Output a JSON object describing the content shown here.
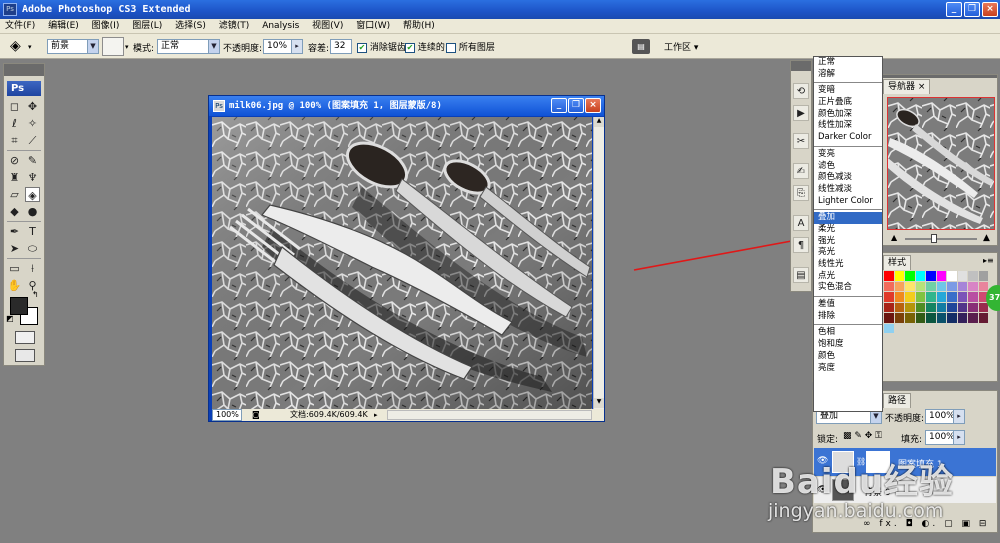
{
  "app": {
    "title": "Adobe Photoshop CS3 Extended",
    "ps_badge": "Ps",
    "window_buttons": {
      "minimize": "_",
      "restore": "❐",
      "close": "×"
    }
  },
  "menubar": [
    "文件(F)",
    "编辑(E)",
    "图像(I)",
    "图层(L)",
    "选择(S)",
    "滤镜(T)",
    "Analysis",
    "视图(V)",
    "窗口(W)",
    "帮助(H)"
  ],
  "options_bar": {
    "fill_source": "前景",
    "mode_label": "模式:",
    "mode_value": "正常",
    "opacity_label": "不透明度:",
    "opacity_value": "10%",
    "tolerance_label": "容差:",
    "tolerance_value": "32",
    "antialias_label": "消除锯齿",
    "contiguous_label": "连续的",
    "all_layers_label": "所有图层",
    "workspace_label": "工作区"
  },
  "toolbox": {
    "logo": "Ps"
  },
  "document": {
    "title": "milk06.jpg @ 100% (图案填充 1, 图层蒙版/8)",
    "zoom": "100%",
    "doc_info": "文档:609.4K/609.4K"
  },
  "navigator": {
    "tab": "导航器"
  },
  "swatches": {
    "tab": "样式"
  },
  "blend_menu": {
    "groups": [
      [
        "正常",
        "溶解"
      ],
      [
        "变暗",
        "正片叠底",
        "颜色加深",
        "线性加深",
        "Darker Color"
      ],
      [
        "变亮",
        "滤色",
        "颜色减淡",
        "线性减淡",
        "Lighter Color"
      ],
      [
        "叠加",
        "柔光",
        "强光",
        "亮光",
        "线性光",
        "点光",
        "实色混合"
      ],
      [
        "差值",
        "排除"
      ],
      [
        "色相",
        "饱和度",
        "颜色",
        "亮度"
      ]
    ],
    "selected": "叠加"
  },
  "layers": {
    "tab": "路径",
    "blend_value": "叠加",
    "opacity_label": "不透明度:",
    "opacity_value": "100%",
    "lock_label": "锁定:",
    "fill_label": "填充:",
    "fill_value": "100%",
    "layer_name": "图案填充 1",
    "bg_layer_name": "背景 0",
    "bottom_icons": "∞ fx. ◘ ◐. ▢ ▣ ⊟"
  },
  "badge": "37",
  "watermark": {
    "line1": "Baidu经验",
    "line2": "jingyan.baidu.com"
  },
  "colors": {
    "accent_red_arrow": "#e01818",
    "selection_blue": "#316ac5",
    "xp_title": "#1d54c7"
  }
}
